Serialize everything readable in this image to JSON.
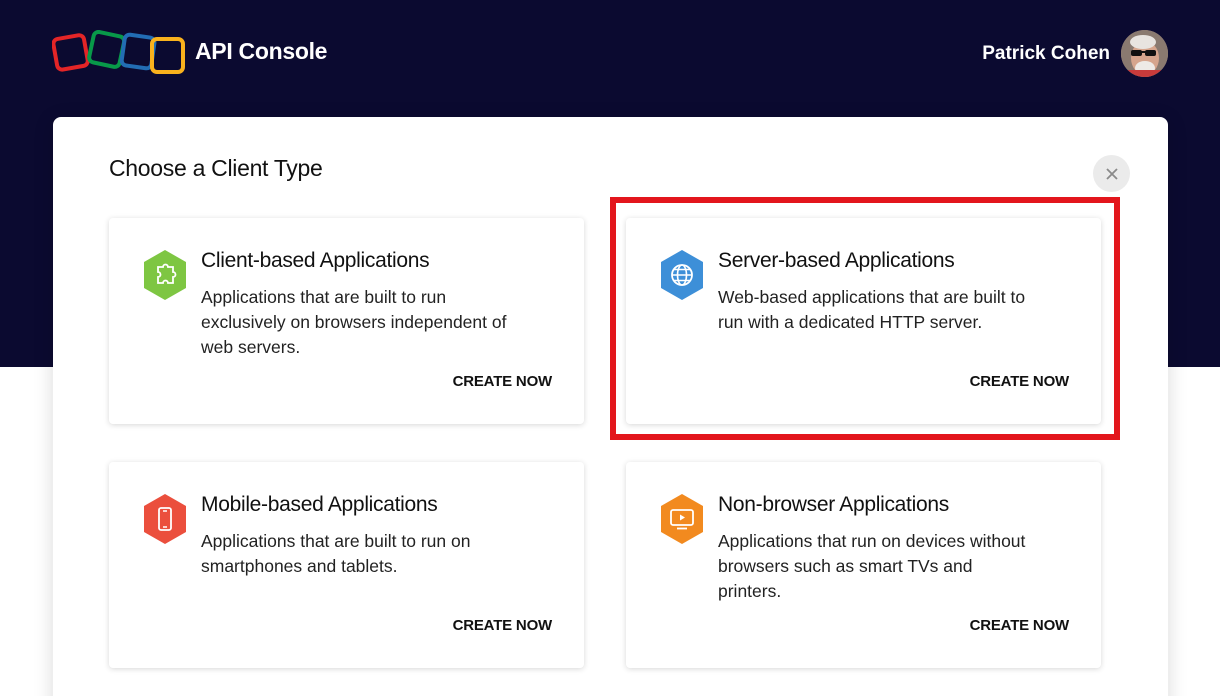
{
  "header": {
    "app_title": "API Console",
    "user_name": "Patrick Cohen",
    "logo_colors": [
      "#e42527",
      "#089949",
      "#226db4",
      "#f9b21d"
    ],
    "background_color": "#0b0a30"
  },
  "modal": {
    "title": "Choose a Client Type",
    "close_icon": "close-icon"
  },
  "cards": [
    {
      "title": "Client-based Applications",
      "description": "Applications that are built to run exclusively on browsers independent of web servers.",
      "action": "CREATE NOW",
      "icon": "puzzle-icon",
      "color": "#7ec642"
    },
    {
      "title": "Server-based Applications",
      "description": "Web-based applications that are built to run with a dedicated HTTP server.",
      "action": "CREATE NOW",
      "icon": "globe-icon",
      "color": "#3d8fd8"
    },
    {
      "title": "Mobile-based Applications",
      "description": "Applications that are built to run on smartphones and tablets.",
      "action": "CREATE NOW",
      "icon": "smartphone-icon",
      "color": "#eb4f3d"
    },
    {
      "title": "Non-browser Applications",
      "description": "Applications that run on devices without browsers such as smart TVs and printers.",
      "action": "CREATE NOW",
      "icon": "monitor-icon",
      "color": "#f28a1f"
    }
  ],
  "highlight_color": "#e3161c"
}
